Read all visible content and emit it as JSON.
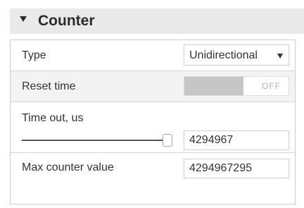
{
  "header": {
    "title": "Counter"
  },
  "rows": {
    "type": {
      "label": "Type",
      "value": "Unidirectional"
    },
    "reset_time": {
      "label": "Reset time",
      "state": "OFF"
    },
    "time_out": {
      "label": "Time out, us",
      "value": "4294967",
      "slider_fraction": 1.0
    },
    "max_counter": {
      "label": "Max counter value",
      "value": "4294967295"
    }
  },
  "icons": {
    "collapse": "caret-down-icon",
    "select": "chevron-down-icon"
  },
  "colors": {
    "header_bg": "#e9e9e9",
    "toggle_off": "#c6c6c6",
    "text": "#333333"
  }
}
